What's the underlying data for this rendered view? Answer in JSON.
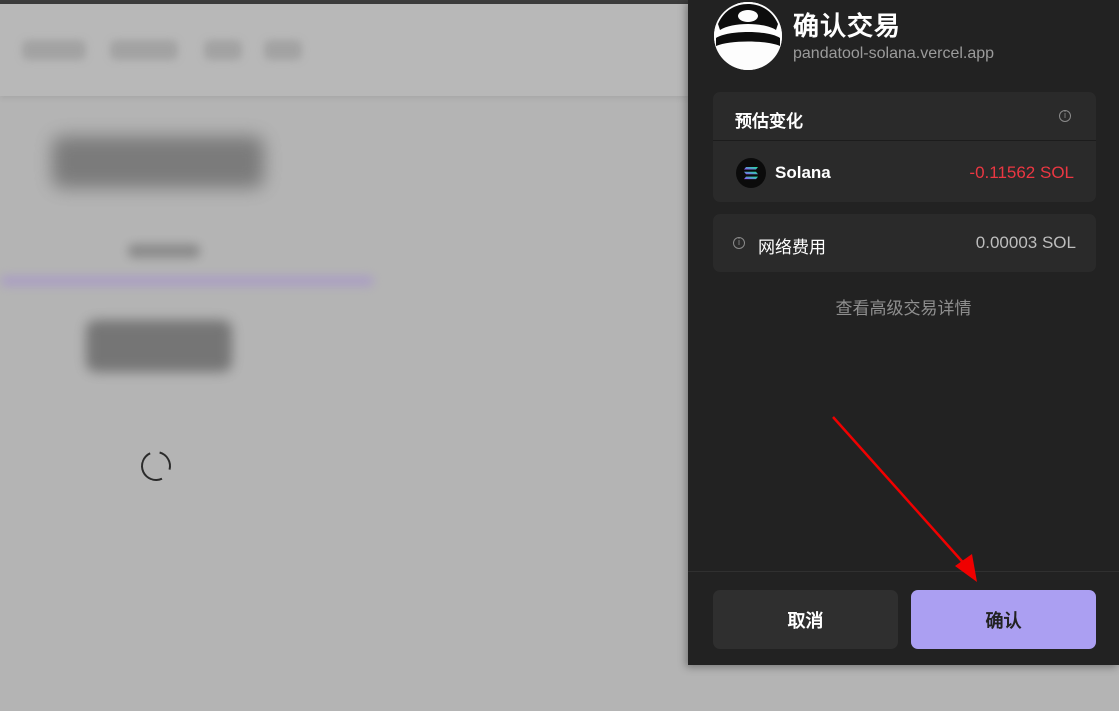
{
  "background_page": {
    "loading_spinner": "loading"
  },
  "wallet_popup": {
    "title": "确认交易",
    "origin": "pandatool-solana.vercel.app",
    "avatar_icon": "panda-avatar-icon",
    "estimated_changes": {
      "header": "预估变化",
      "info_icon": "info-icon",
      "token": {
        "name": "Solana",
        "icon": "solana-logo-icon",
        "amount": "-0.11562 SOL",
        "amount_color": "#eb3742"
      }
    },
    "network_fee": {
      "label": "网络费用",
      "info_icon": "info-icon",
      "value": "0.00003 SOL"
    },
    "advanced_link": "查看高级交易详情",
    "buttons": {
      "cancel": "取消",
      "confirm": "确认"
    },
    "colors": {
      "background": "#222222",
      "card": "#2a2a2a",
      "confirm_button": "#ab9ff2",
      "cancel_button": "#2f2f2f"
    }
  },
  "annotation": {
    "arrow_color": "#f00000",
    "arrow_icon": "red-arrow-icon"
  }
}
